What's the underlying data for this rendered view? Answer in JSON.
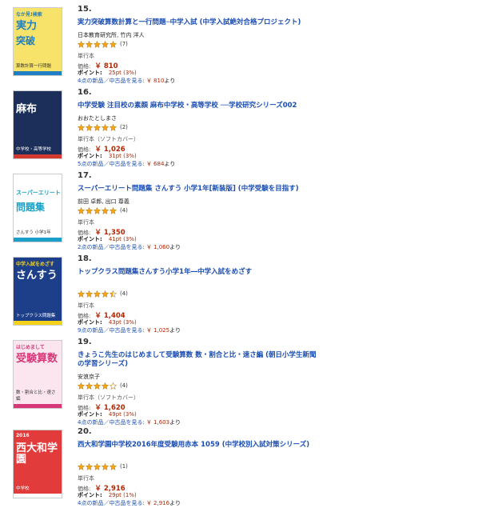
{
  "items": [
    {
      "rank": "15.",
      "title": "実力突破算数計算と一行問題─中学入試 (中学入試絶対合格プロジェクト)",
      "author": "日本教育研究所, 竹内 洋人",
      "stars": 5,
      "count": "(7)",
      "format": "単行本",
      "price_label": "価格:",
      "price": "￥ 810",
      "points_label": "ポイント:",
      "points": "25pt (3%)",
      "offers": "4点の新品／中古品を見る:",
      "offer_price": "￥ 810",
      "yori": "より",
      "cover": {
        "top_text": "なか見!検索",
        "main1": "実力",
        "main2": "突破",
        "side": "算数計算一行問題",
        "bg": "#f7e36a",
        "accent": "#1e7fc5"
      }
    },
    {
      "rank": "16.",
      "title": "中学受験 注目校の素顔 麻布中学校・高等学校 ──学校研究シリーズ002",
      "author": "おおたとしまさ",
      "stars": 5,
      "count": "(2)",
      "format": "単行本（ソフトカバー）",
      "price_label": "価格:",
      "price": "￥ 1,026",
      "points_label": "ポイント:",
      "points": "31pt (3%)",
      "offers": "5点の新品／中古品を見る:",
      "offer_price": "￥ 684",
      "yori": "より",
      "cover": {
        "top_text": "",
        "main1": "麻布",
        "main2": "",
        "side": "中学校・高等学校",
        "bg": "#1c2f5a",
        "accent": "#d23a2f"
      }
    },
    {
      "rank": "17.",
      "title": "スーパーエリート問題集 さんすう 小学1年[新装版] (中学受験を目指す)",
      "author": "前田 卓郎, 出口 尊義",
      "stars": 5,
      "count": "(4)",
      "format": "単行本",
      "price_label": "価格:",
      "price": "￥ 1,350",
      "points_label": "ポイント:",
      "points": "41pt (3%)",
      "offers": "2点の新品／中古品を見る:",
      "offer_price": "￥ 1,060",
      "yori": "より",
      "cover": {
        "top_text": "",
        "main1": "スーパーエリート",
        "main2": "問題集",
        "side": "さんすう 小学1年",
        "bg": "#ffffff",
        "accent": "#1aa0c8"
      }
    },
    {
      "rank": "18.",
      "title": "トップクラス問題集さんすう小学1年―中学入試をめざす",
      "author": "",
      "stars": 4.5,
      "count": "(4)",
      "format": "単行本",
      "price_label": "価格:",
      "price": "￥ 1,404",
      "points_label": "ポイント:",
      "points": "43pt (3%)",
      "offers": "9点の新品／中古品を見る:",
      "offer_price": "￥ 1,025",
      "yori": "より",
      "cover": {
        "top_text": "中学入試をめざす",
        "main1": "さんすう",
        "main2": "",
        "side": "トップクラス問題集",
        "bg": "#1d3f8a",
        "accent": "#f5d21a"
      }
    },
    {
      "rank": "19.",
      "title": "きょうこ先生のはじめまして受験算数 数・割合と比・速さ編 (朝日小学生新聞の学習シリーズ)",
      "author": "安浪京子",
      "stars": 4,
      "count": "(4)",
      "format": "単行本（ソフトカバー）",
      "price_label": "価格:",
      "price": "￥ 1,620",
      "points_label": "ポイント:",
      "points": "49pt (3%)",
      "offers": "4点の新品／中古品を見る:",
      "offer_price": "￥ 1,603",
      "yori": "より",
      "cover": {
        "top_text": "はじめまして",
        "main1": "受験算数",
        "main2": "",
        "side": "数・割合と比・速さ編",
        "bg": "#fbe6ef",
        "accent": "#d8387a"
      }
    },
    {
      "rank": "20.",
      "title": "西大和学園中学校2016年度受験用赤本 1059 (中学校別入試対策シリーズ)",
      "author": "",
      "stars": 5,
      "count": "(1)",
      "format": "単行本",
      "price_label": "価格:",
      "price": "￥ 2,916",
      "points_label": "ポイント:",
      "points": "29pt (1%)",
      "offers": "4点の新品／中古品を見る:",
      "offer_price": "￥ 2,916",
      "yori": "より",
      "cover": {
        "top_text": "2016",
        "main1": "西大和学園",
        "main2": "",
        "side": "中学校",
        "bg": "#e23b3b",
        "accent": "#ffffff"
      }
    }
  ],
  "colors": {
    "link": "#1a4db3",
    "price": "#b12704",
    "star": "#f4a418"
  }
}
